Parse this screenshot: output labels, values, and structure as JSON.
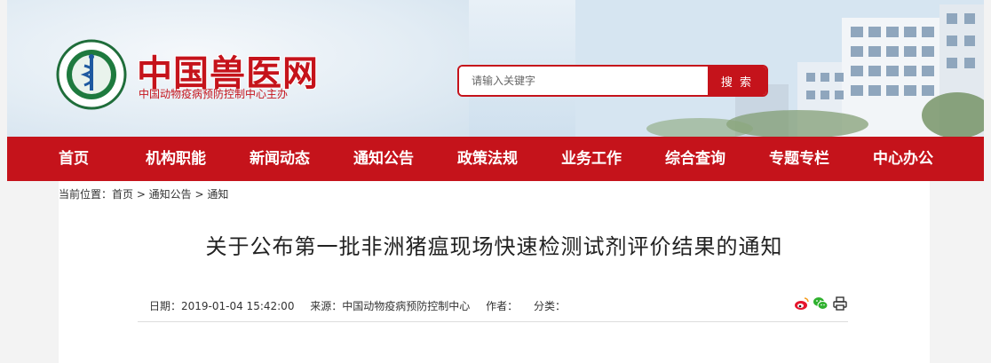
{
  "header": {
    "site_title": "中国兽医网",
    "site_subtitle": "中国动物疫病预防控制中心主办",
    "logo_text": "中国动物疫病预防控制中心"
  },
  "search": {
    "placeholder": "请输入关键字",
    "button_label": "搜 索"
  },
  "nav": {
    "items": [
      {
        "label": "首页"
      },
      {
        "label": "机构职能"
      },
      {
        "label": "新闻动态"
      },
      {
        "label": "通知公告"
      },
      {
        "label": "政策法规"
      },
      {
        "label": "业务工作"
      },
      {
        "label": "综合查询"
      },
      {
        "label": "专题专栏"
      },
      {
        "label": "中心办公"
      }
    ]
  },
  "breadcrumb": {
    "text": "当前位置：首页 > 通知公告 > 通知"
  },
  "article": {
    "title": "关于公布第一批非洲猪瘟现场快速检测试剂评价结果的通知",
    "date": "日期：2019-01-04 15:42:00",
    "source": "来源：中国动物疫病预防控制中心",
    "author": "作者：",
    "category": "分类："
  },
  "colors": {
    "brand_red": "#c5131b",
    "nav_bg": "#c5131b"
  },
  "icons": [
    "weibo-icon",
    "wechat-icon",
    "print-icon"
  ]
}
